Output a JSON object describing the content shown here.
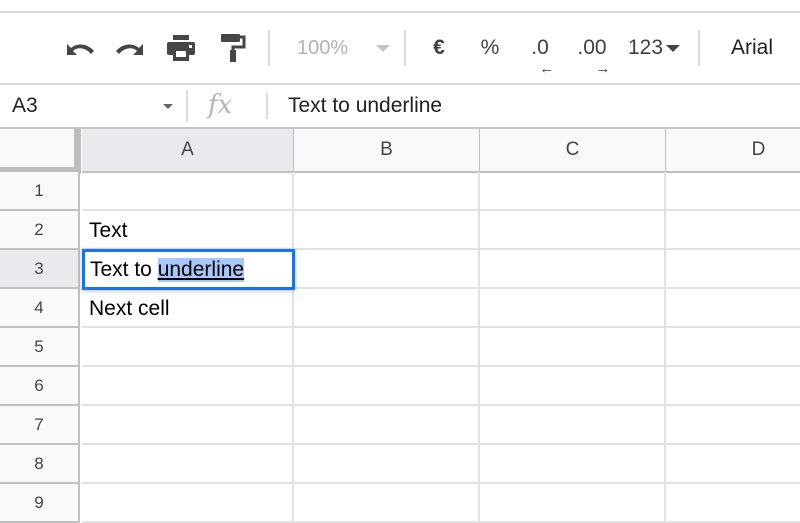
{
  "toolbar": {
    "undo": "undo-icon",
    "redo": "redo-icon",
    "print": "print-icon",
    "paint_format": "paint-format-icon",
    "zoom_value": "100%",
    "currency_label": "€",
    "percent_label": "%",
    "decrease_decimal_label": ".0",
    "decrease_decimal_arrow": "←",
    "increase_decimal_label": ".00",
    "increase_decimal_arrow": "→",
    "number_format_label": "123",
    "font_value": "Arial"
  },
  "formula_bar": {
    "name_box": "A3",
    "fx_label": "fx",
    "value": "Text to underline"
  },
  "sheet": {
    "columns": [
      "A",
      "B",
      "C",
      "D"
    ],
    "selected_column": "A",
    "rows": [
      "1",
      "2",
      "3",
      "4",
      "5",
      "6",
      "7",
      "8",
      "9"
    ],
    "selected_row": "3",
    "cells": {
      "A2": "Text",
      "A3_prefix": "Text to ",
      "A3_selected": "underline",
      "A4": "Next cell"
    },
    "active_cell": "A3",
    "accent_color": "#1a73e8",
    "selection_highlight": "#a8c7fa"
  }
}
